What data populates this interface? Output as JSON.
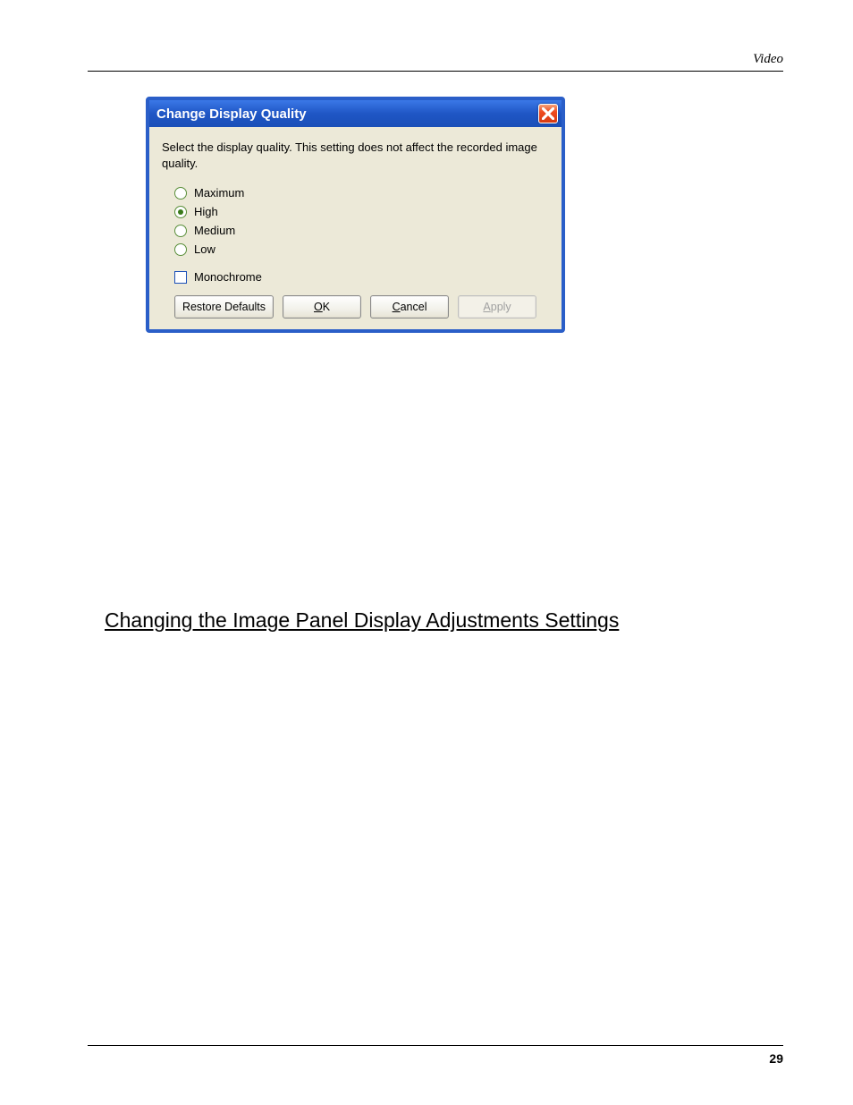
{
  "header": {
    "section": "Video"
  },
  "footer": {
    "page_number": "29"
  },
  "dialog": {
    "title": "Change Display Quality",
    "instruction": "Select the display quality.  This setting does not affect the recorded image quality.",
    "options": {
      "maximum": "Maximum",
      "high": "High",
      "medium": "Medium",
      "low": "Low",
      "monochrome": "Monochrome"
    },
    "selected": "high",
    "buttons": {
      "restore": "Restore Defaults",
      "ok_accel": "O",
      "ok_rest": "K",
      "cancel_accel": "C",
      "cancel_rest": "ancel",
      "apply_accel": "A",
      "apply_rest": "pply"
    }
  },
  "section_heading": "Changing the Image Panel Display Adjustments Settings"
}
